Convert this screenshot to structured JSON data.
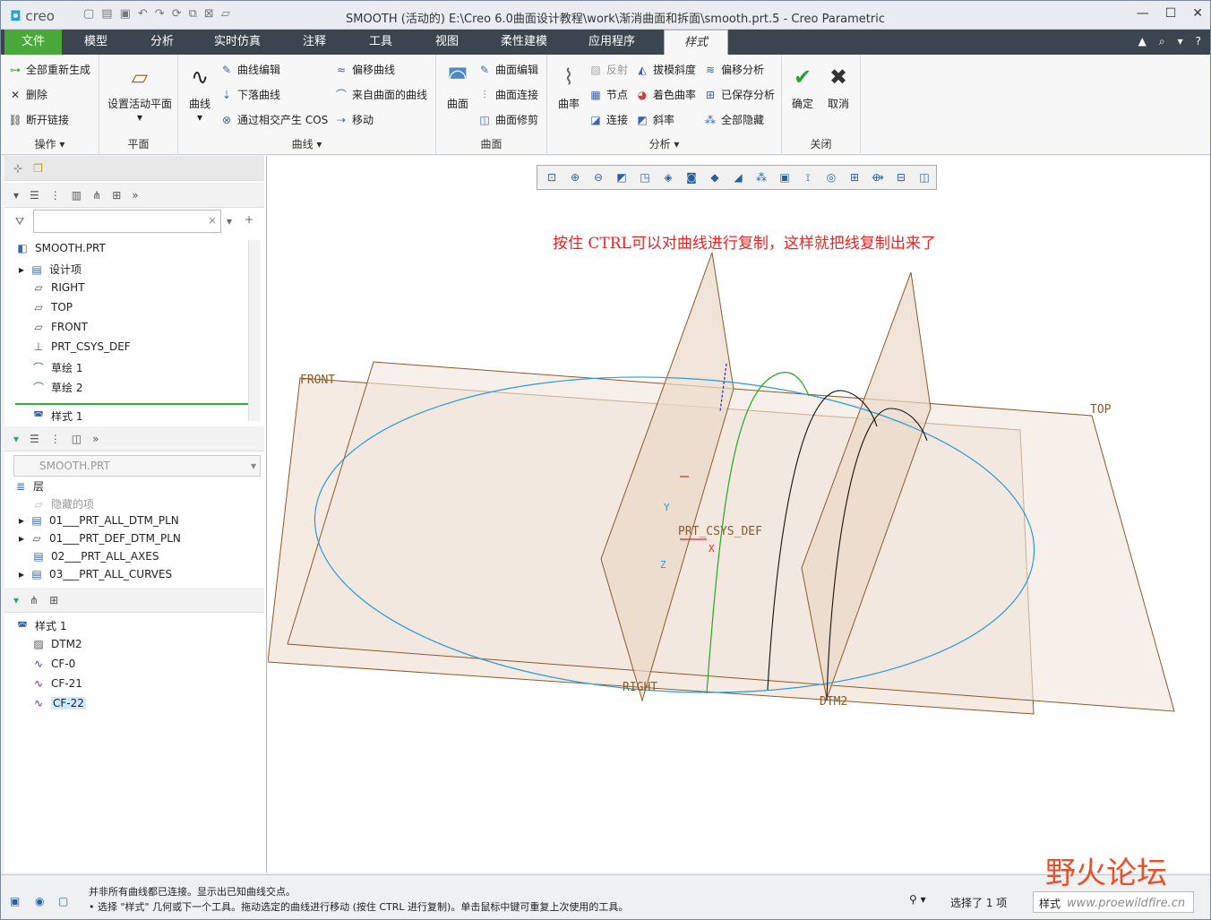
{
  "app": {
    "logo": "creo",
    "title": "SMOOTH (活动的) E:\\Creo 6.0曲面设计教程\\work\\渐消曲面和拆面\\smooth.prt.5 - Creo Parametric"
  },
  "ribbon_tabs": [
    "文件",
    "模型",
    "分析",
    "实时仿真",
    "注释",
    "工具",
    "视图",
    "柔性建模",
    "应用程序",
    "样式"
  ],
  "ribbon": {
    "ops": {
      "regen": "全部重新生成",
      "delete": "删除",
      "disconnect": "断开链接",
      "label": "操作"
    },
    "plane": {
      "set_active": "设置活动平面",
      "label": "平面"
    },
    "curves": {
      "curve": "曲线",
      "curve_edit": "曲线编辑",
      "drop_curve": "下落曲线",
      "cos": "通过相交产生 COS",
      "offset": "偏移曲线",
      "from_surface": "来自曲面的曲线",
      "move": "移动",
      "label": "曲线"
    },
    "surfaces": {
      "surface": "曲面",
      "surface_edit": "曲面编辑",
      "surface_connect": "曲面连接",
      "surface_trim": "曲面修剪",
      "label": "曲面"
    },
    "analysis": {
      "curvature": "曲率",
      "reflect": "反射",
      "draft": "拔模斜度",
      "offset": "偏移分析",
      "node": "节点",
      "shade_curv": "着色曲率",
      "saved": "已保存分析",
      "connect": "连接",
      "slope": "斜率",
      "hide_all": "全部隐藏",
      "label": "分析"
    },
    "close": {
      "ok": "确定",
      "cancel": "取消",
      "label": "关闭"
    }
  },
  "model_tree": {
    "root": "SMOOTH.PRT",
    "items": [
      "设计项",
      "RIGHT",
      "TOP",
      "FRONT",
      "PRT_CSYS_DEF",
      "草绘 1",
      "草绘 2",
      "样式 1"
    ]
  },
  "layer_tree": {
    "part": "SMOOTH.PRT",
    "header": "层",
    "items": [
      "隐藏的项",
      "01___PRT_ALL_DTM_PLN",
      "01___PRT_DEF_DTM_PLN",
      "02___PRT_ALL_AXES",
      "03___PRT_ALL_CURVES"
    ]
  },
  "style_tree": {
    "root": "样式 1",
    "items": [
      "DTM2",
      "CF-0",
      "CF-21",
      "CF-22"
    ]
  },
  "viewport": {
    "note": "按住 CTRL可以对曲线进行复制，这样就把线复制出来了",
    "labels": {
      "front": "FRONT",
      "top": "TOP",
      "right": "RIGHT",
      "csys": "PRT_CSYS_DEF",
      "dtm2": "DTM2",
      "x": "X",
      "y": "Y",
      "z": "Z"
    }
  },
  "status": {
    "line1": "并非所有曲线都已连接。显示出已知曲线交点。",
    "line2": "• 选择 \"样式\" 几何或下一个工具。拖动选定的曲线进行移动 (按住 CTRL 进行复制)。单击鼠标中键可重复上次使用的工具。",
    "selected": "选择了 1 项",
    "filter": "样式"
  },
  "watermark": {
    "text": "野火论坛",
    "url": "www.proewildfire.cn"
  },
  "colors": {
    "file_tab": "#4aa83a",
    "tabbar": "#3b4550",
    "datum": "#8a5a2a",
    "sketch": "#2a9ad8",
    "style_curve": "#22aa22",
    "note": "#e22222"
  }
}
